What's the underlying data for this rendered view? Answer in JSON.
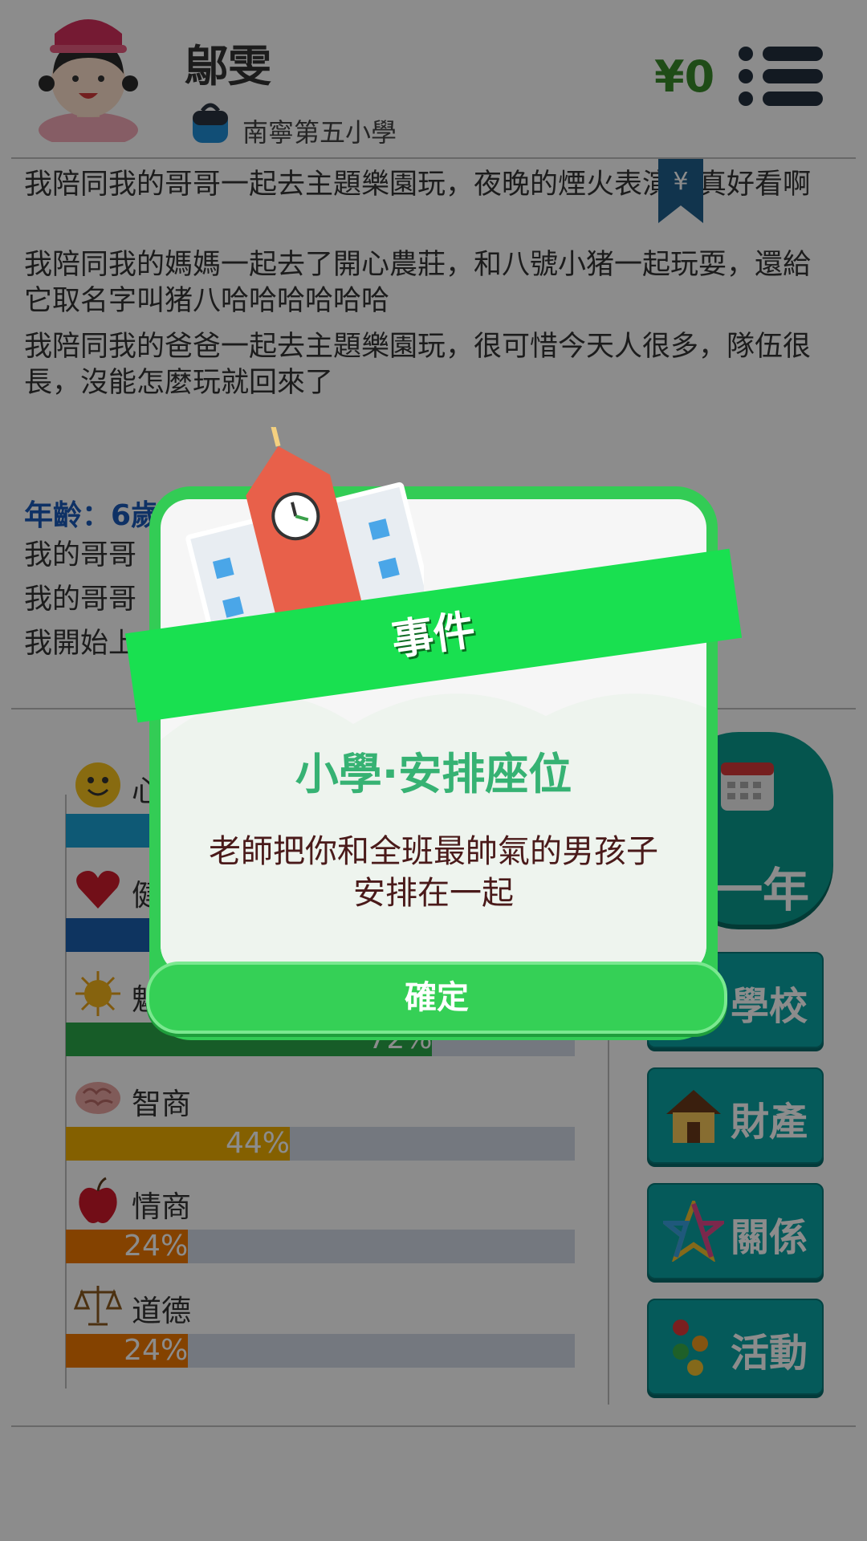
{
  "header": {
    "name": "鄔雯",
    "school": "南寧第五小學",
    "money": "¥0",
    "bookmark_symbol": "¥"
  },
  "log": {
    "lines": [
      "我陪同我的哥哥一起去主題樂園玩，夜晚的煙火表演可真好看啊",
      "我陪同我的媽媽一起去了開心農莊，和八號小猪一起玩耍，還給它取名字叫猪八哈哈哈哈哈哈",
      "我陪同我的爸爸一起去主題樂園玩，很可惜今天人很多，隊伍很長，沒能怎麼玩就回來了"
    ],
    "age": "年齡：6歲",
    "partial_lines": [
      "我的哥哥",
      "我的哥哥",
      "我開始上"
    ]
  },
  "stats": [
    {
      "label": "心",
      "percent": null,
      "color": "#1ba3d6"
    },
    {
      "label": "健",
      "percent": null,
      "color": "#1a5fb0"
    },
    {
      "label": "魅",
      "percent": "72%",
      "value": 0.72,
      "color": "#2aa84a"
    },
    {
      "label": "智商",
      "percent": "44%",
      "value": 0.44,
      "color": "#f0b000"
    },
    {
      "label": "情商",
      "percent": "24%",
      "value": 0.24,
      "color": "#f07800"
    },
    {
      "label": "道德",
      "percent": "24%",
      "value": 0.24,
      "color": "#f07800"
    }
  ],
  "actions": {
    "year": "一年",
    "school": "學校",
    "property": "財產",
    "relations": "關係",
    "activities": "活動"
  },
  "dialog": {
    "ribbon": "事件",
    "title": "小學·安排座位",
    "body_line1": "老師把你和全班最帥氣的男孩子",
    "body_line2": "安排在一起",
    "ok": "確定"
  }
}
